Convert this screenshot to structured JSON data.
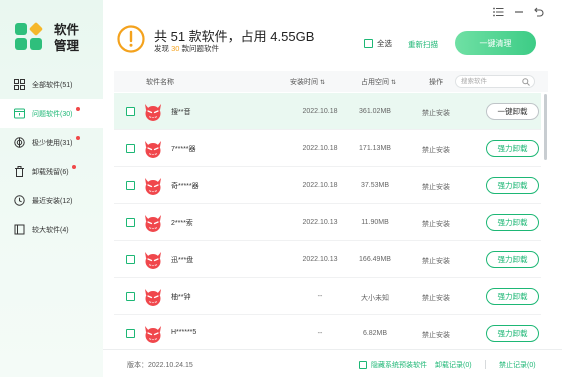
{
  "app": {
    "title_line1": "软件",
    "title_line2": "管理",
    "brand_color": "#1db775"
  },
  "window_controls": {
    "menu_icon": "list-icon",
    "minimize_icon": "minimize-icon",
    "back_icon": "back-arrow-icon"
  },
  "sidebar": {
    "items": [
      {
        "label": "全部软件(51)",
        "icon": "grid-icon",
        "active": false,
        "dot": false
      },
      {
        "label": "问题软件(30)",
        "icon": "warning-window-icon",
        "active": true,
        "dot": true
      },
      {
        "label": "极少使用(31)",
        "icon": "radar-icon",
        "active": false,
        "dot": true
      },
      {
        "label": "卸载残留(6)",
        "icon": "trash-icon",
        "active": false,
        "dot": true
      },
      {
        "label": "最近安装(12)",
        "icon": "clock-icon",
        "active": false,
        "dot": false
      },
      {
        "label": "较大软件(4)",
        "icon": "box-icon",
        "active": false,
        "dot": false
      }
    ]
  },
  "header": {
    "title": "共 51 款软件，占用 4.55GB",
    "sub_prefix": "发现",
    "sub_count": "30",
    "sub_suffix": "款问题软件",
    "select_all": "全选",
    "rescan": "重新扫描",
    "clean_button": "一键清理",
    "warning_icon": "exclamation-circle-icon"
  },
  "table": {
    "columns": {
      "name": "软件名称",
      "install_time": "安装时间",
      "space": "占用空间",
      "action": "操作"
    },
    "search_placeholder": "搜索软件",
    "rows": [
      {
        "name": "搜**音",
        "date": "2022.10.18",
        "size": "361.02MB",
        "status": "禁止安装",
        "action": "一键卸载",
        "selected": true
      },
      {
        "name": "7*****器",
        "date": "2022.10.18",
        "size": "171.13MB",
        "status": "禁止安装",
        "action": "强力卸载",
        "selected": false
      },
      {
        "name": "奇*****器",
        "date": "2022.10.18",
        "size": "37.53MB",
        "status": "禁止安装",
        "action": "强力卸载",
        "selected": false
      },
      {
        "name": "2****索",
        "date": "2022.10.13",
        "size": "11.90MB",
        "status": "禁止安装",
        "action": "强力卸载",
        "selected": false
      },
      {
        "name": "迅***盘",
        "date": "2022.10.13",
        "size": "166.49MB",
        "status": "禁止安装",
        "action": "强力卸载",
        "selected": false
      },
      {
        "name": "柚**钟",
        "date": "--",
        "size": "大小未知",
        "status": "禁止安装",
        "action": "强力卸载",
        "selected": false
      },
      {
        "name": "H******5",
        "date": "--",
        "size": "6.82MB",
        "status": "禁止安装",
        "action": "强力卸载",
        "selected": false
      }
    ]
  },
  "footer": {
    "version": "版本：2022.10.24.15",
    "hide_system": "隐藏系统预装软件",
    "uninstall_log": "卸载记录(0)",
    "block_log": "禁止记录(0)"
  }
}
